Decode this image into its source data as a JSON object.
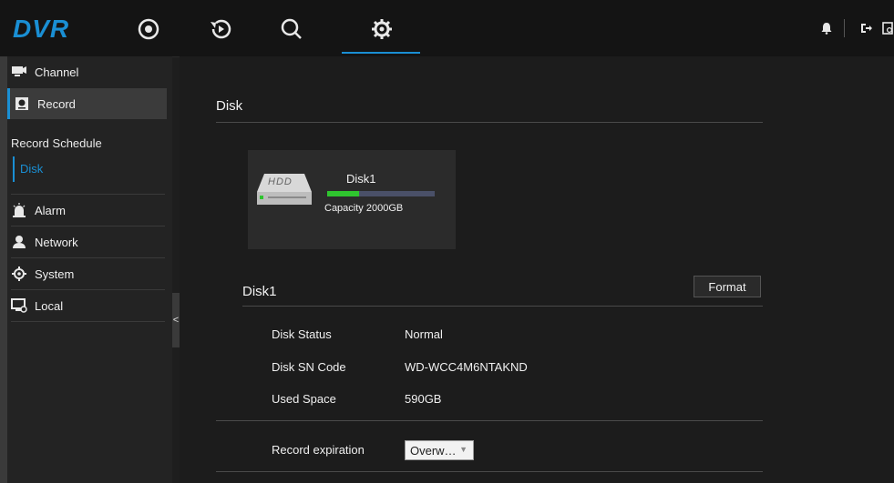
{
  "header": {
    "logo": "DVR",
    "nav": [
      {
        "icon": "live-view-icon"
      },
      {
        "icon": "playback-icon"
      },
      {
        "icon": "search-icon"
      },
      {
        "icon": "settings-gear-icon",
        "active": true
      }
    ],
    "right_icons": [
      "alarm-bell-icon",
      "logout-icon",
      "lock-screen-icon"
    ],
    "accent_color": "#1a8fd4"
  },
  "sidebar": {
    "items": [
      {
        "label": "Channel",
        "icon": "channel-monitor-icon"
      },
      {
        "label": "Record",
        "icon": "record-icon",
        "active": true
      },
      {
        "label": "Alarm",
        "icon": "alarm-icon"
      },
      {
        "label": "Network",
        "icon": "network-user-icon"
      },
      {
        "label": "System",
        "icon": "system-gear-icon"
      },
      {
        "label": "Local",
        "icon": "local-monitor-icon"
      }
    ],
    "record_sub": [
      {
        "label": "Record Schedule"
      },
      {
        "label": "Disk",
        "active": true
      }
    ],
    "collapse_label": "<"
  },
  "main": {
    "section_title": "Disk",
    "disk_card": {
      "hdd_label": "HDD",
      "name": "Disk1",
      "capacity": "Capacity 2000GB",
      "used_fraction": 0.295
    },
    "detail_title": "Disk1",
    "format_label": "Format",
    "rows": [
      {
        "label": "Disk Status",
        "value": "Normal"
      },
      {
        "label": "Disk SN Code",
        "value": "WD-WCC4M6NTAKND"
      },
      {
        "label": "Used Space",
        "value": "590GB"
      }
    ],
    "expiration": {
      "label": "Record expiration",
      "value": "Overw…"
    }
  }
}
